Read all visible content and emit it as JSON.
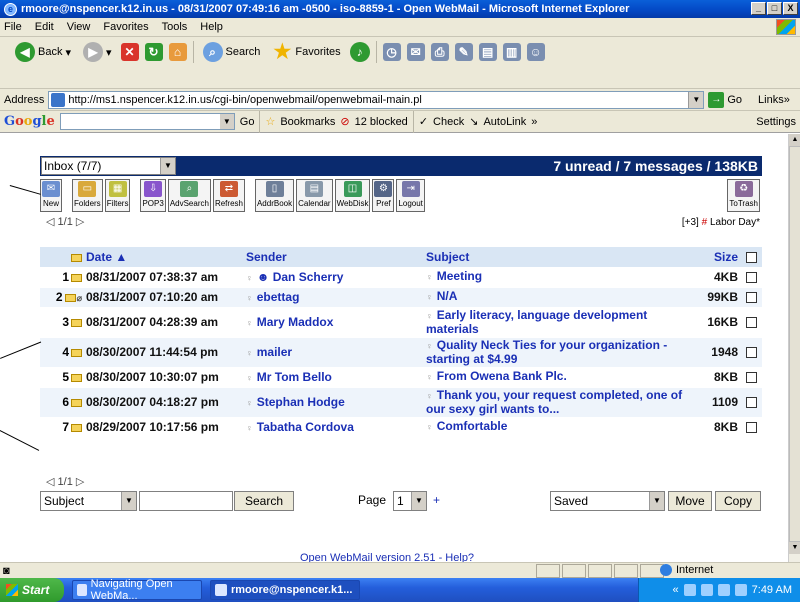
{
  "window": {
    "title": "rmoore@nspencer.k12.in.us - 08/31/2007 07:49:16 am -0500 - iso-8859-1 - Open WebMail - Microsoft Internet Explorer",
    "controls": [
      "_",
      "□",
      "X"
    ]
  },
  "menu": [
    "File",
    "Edit",
    "View",
    "Favorites",
    "Tools",
    "Help"
  ],
  "toolbar": {
    "back": "Back",
    "search": "Search",
    "favorites": "Favorites"
  },
  "address": {
    "label": "Address",
    "url": "http://ms1.nspencer.k12.in.us/cgi-bin/openwebmail/openwebmail-main.pl",
    "go": "Go",
    "links": "Links"
  },
  "google_bar": {
    "logo": "Google",
    "go": "Go",
    "bookmarks": "Bookmarks",
    "blocked": "12 blocked",
    "check": "Check",
    "autolink": "AutoLink",
    "settings": "Settings"
  },
  "webmail": {
    "folder": "Inbox (7/7)",
    "summary": "7 unread / 7 messages / 138KB",
    "buttons": [
      "New",
      "Folders",
      "Filters",
      "POP3",
      "AdvSearch",
      "Refresh",
      "AddrBook",
      "Calendar",
      "WebDisk",
      "Pref",
      "Logout"
    ],
    "to_trash": "ToTrash",
    "pager_top": "1/1",
    "event": "[+3]",
    "event_hash": "#",
    "event_label": "Labor Day*",
    "columns": {
      "date": "Date",
      "sender": "Sender",
      "subject": "Subject",
      "size": "Size"
    },
    "messages": [
      {
        "num": "1",
        "date": "08/31/2007 07:38:37 am",
        "sender": "Dan Scherry",
        "subject": "Meeting",
        "size": "4KB"
      },
      {
        "num": "2",
        "date": "08/31/2007 07:10:20 am",
        "sender": "ebettag",
        "subject": "N/A",
        "size": "99KB"
      },
      {
        "num": "3",
        "date": "08/31/2007 04:28:39 am",
        "sender": "Mary Maddox",
        "subject": "Early literacy, language development materials",
        "size": "16KB"
      },
      {
        "num": "4",
        "date": "08/30/2007 11:44:54 pm",
        "sender": "mailer",
        "subject": "Quality Neck Ties for your organization - starting at $4.99",
        "size": "1948"
      },
      {
        "num": "5",
        "date": "08/30/2007 10:30:07 pm",
        "sender": "Mr Tom Bello",
        "subject": "From Owena Bank Plc.",
        "size": "8KB"
      },
      {
        "num": "6",
        "date": "08/30/2007 04:18:27 pm",
        "sender": "Stephan Hodge",
        "subject": "Thank you, your request completed, one of our sexy girl wants to...",
        "size": "1109"
      },
      {
        "num": "7",
        "date": "08/29/2007 10:17:56 pm",
        "sender": "Tabatha Cordova",
        "subject": "Comfortable",
        "size": "8KB"
      }
    ],
    "pager_bottom": "1/1",
    "search_field": "Subject",
    "search_button": "Search",
    "page_label": "Page",
    "page_value": "1",
    "page_plus": "+",
    "move_target": "Saved",
    "move_button": "Move",
    "copy_button": "Copy",
    "footer": "Open WebMail version 2.51 - Help?"
  },
  "status": {
    "zone": "Internet"
  },
  "taskbar": {
    "start": "Start",
    "tasks": [
      "Navigating Open WebMa...",
      "rmoore@nspencer.k1..."
    ],
    "clock": "7:49 AM"
  },
  "colors": {
    "header_bar": "#0a2a6e",
    "link": "#1a2fb5",
    "row_alt": "#eef4fb",
    "column_header": "#d9e6f4"
  }
}
